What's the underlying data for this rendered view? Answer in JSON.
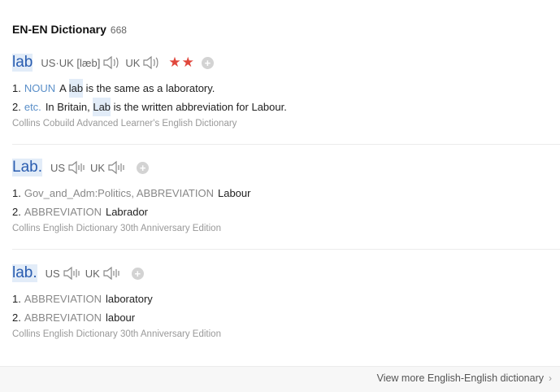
{
  "header": {
    "title": "EN-EN Dictionary",
    "count": "668"
  },
  "entries": [
    {
      "word": "lab",
      "pron_us_label": "US·UK [læb]",
      "pron_uk_label": "UK",
      "stars": "★★",
      "plus": "+",
      "defs": [
        {
          "num": "1.",
          "pos": "NOUN",
          "text_before": "A ",
          "text_hl": "lab",
          "text_after": " is the same as a laboratory."
        },
        {
          "num": "2.",
          "pos": "etc.",
          "text_before": "In Britain, ",
          "text_hl": "Lab",
          "text_after": " is the written abbreviation for Labour."
        }
      ],
      "source": "Collins Cobuild Advanced Learner's English Dictionary"
    },
    {
      "word": "Lab.",
      "pron_us_label": "US",
      "pron_uk_label": "UK",
      "plus": "+",
      "defs": [
        {
          "num": "1.",
          "pos": "Gov_and_Adm:Politics, ABBREVIATION",
          "text": "Labour"
        },
        {
          "num": "2.",
          "pos": "ABBREVIATION",
          "text": "Labrador"
        }
      ],
      "source": "Collins English Dictionary 30th Anniversary Edition"
    },
    {
      "word": "lab.",
      "pron_us_label": "US",
      "pron_uk_label": "UK",
      "plus": "+",
      "defs": [
        {
          "num": "1.",
          "pos": "ABBREVIATION",
          "text": "laboratory"
        },
        {
          "num": "2.",
          "pos": "ABBREVIATION",
          "text": "labour"
        }
      ],
      "source": "Collins English Dictionary 30th Anniversary Edition"
    }
  ],
  "footer": {
    "more_label": "View more English-English dictionary",
    "chevron": "›"
  },
  "colors": {
    "word": "#2a5db0",
    "pos": "#5a8fc9",
    "stars": "#e0473c",
    "highlight": "#e2ecf8"
  }
}
